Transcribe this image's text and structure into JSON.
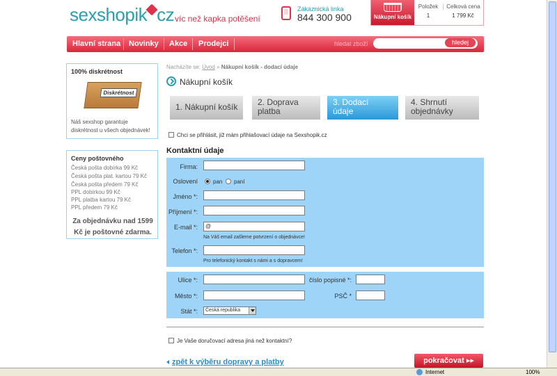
{
  "header": {
    "logo_left": "sexshopik",
    "logo_right": "cz",
    "tagline": "víc než kapka potěšení",
    "phone_label": "Zákaznická linka",
    "phone_number": "844 300 900",
    "cart_button": "Nákupní košík",
    "cart_items_label": "Položek",
    "cart_items_value": "1",
    "cart_total_label": "Celková cena",
    "cart_total_value": "1 799 Kč"
  },
  "nav": {
    "items": [
      "Hlavní strana",
      "Novinky",
      "Akce",
      "Prodejci"
    ],
    "search_label": "hledat zboží",
    "search_button": "hledej"
  },
  "sidebar": {
    "discretion_title": "100% diskrétnost",
    "discretion_box_label": "Diskrétnost",
    "discretion_text": "Náš sexshop garantuje diskrétnost u všech objednávek!",
    "postage_title": "Ceny poštovného",
    "postage_items": [
      "Česká pošta dobírka 99 Kč",
      "Česká pošta plat. kartou 79 Kč",
      "Česká pošta předem 79 Kč",
      "PPL dobírkou 99 Kč",
      "PPL platba kartou 79 Kč",
      "PPL předem 79 Kč"
    ],
    "free_shipping": "Za objednávku nad 1599 Kč je poštovné zdarma."
  },
  "content": {
    "breadcrumb_prefix": "Nacházíte se:",
    "breadcrumb_home": "Úvod",
    "breadcrumb_sep": "»",
    "breadcrumb_current": "Nákupní košík - dodací údaje",
    "page_title": "Nákupní košík",
    "steps": [
      {
        "label": "1. Nákupní košík",
        "active": false
      },
      {
        "label": "2. Doprava platba",
        "active": false
      },
      {
        "label": "3. Dodací údaje",
        "active": true
      },
      {
        "label": "4. Shrnutí objednávky",
        "active": false
      }
    ],
    "login_checkbox": "Chci se přihlásit, již mám přihlašovací údaje na Sexshopik.cz",
    "contact_title": "Kontaktní údaje",
    "form": {
      "company": "Firma:",
      "salutation": "Oslovení",
      "mr": "pan",
      "mrs": "paní",
      "firstname": "Jméno *:",
      "lastname": "Příjmení *:",
      "email": "E-mail *:",
      "email_value": "@",
      "email_note": "Na Váš email zašleme potvrzení o objednávce!",
      "phone": "Telefon *:",
      "phone_note": "Pro telefonický kontakt s námi a s dopravcem!",
      "street": "Ulice *:",
      "house_number": "číslo popisné *:",
      "city": "Město *:",
      "zip": "PSČ *",
      "country": "Stát *:",
      "country_value": "Česká republika"
    },
    "alt_address_checkbox": "Je Vaše doručovací adresa jiná než kontaktní?",
    "back_link": "zpět k výběru dopravy a platby",
    "continue_button": "pokračovat ▸▸"
  },
  "statusbar": {
    "zone": "Internet",
    "zoom": "100%"
  },
  "colors": {
    "brand_red": "#d9263b",
    "brand_teal": "#2aa0ae",
    "form_blue": "#9dd4f7",
    "step_active": "#2a98d8"
  }
}
